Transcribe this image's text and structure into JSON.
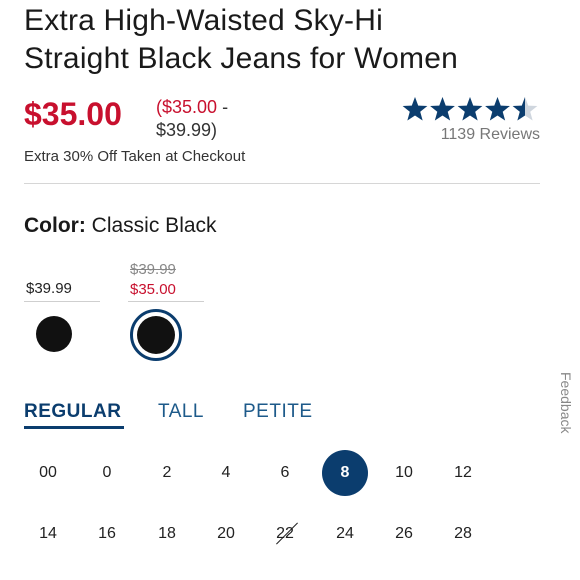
{
  "product": {
    "title_line1": "Extra High-Waisted Sky-Hi",
    "title_line2": "Straight Black Jeans for Women"
  },
  "pricing": {
    "sale_price": "$35.00",
    "range_low": "($35.00",
    "range_sep": " -",
    "range_high": "$39.99)",
    "promo": "Extra 30% Off Taken at Checkout"
  },
  "rating": {
    "value": 4.5,
    "max": 5,
    "reviews_text": "1139 Reviews",
    "star_color": "#0b3d6e"
  },
  "color": {
    "label": "Color:",
    "selected": "Classic Black"
  },
  "swatches": [
    {
      "price": "$39.99",
      "icon": "black-swatch"
    },
    {
      "old_price": "$39.99",
      "new_price": "$35.00",
      "icon": "black-swatch-selected"
    }
  ],
  "fit_tabs": [
    {
      "label": "REGULAR",
      "active": true
    },
    {
      "label": "TALL",
      "active": false
    },
    {
      "label": "PETITE",
      "active": false
    }
  ],
  "sizes": {
    "row1": [
      "00",
      "0",
      "2",
      "4",
      "6",
      "8",
      "10",
      "12"
    ],
    "row2": [
      "14",
      "16",
      "18",
      "20",
      "22",
      "24",
      "26",
      "28"
    ],
    "selected": "8",
    "unavailable": [
      "22"
    ]
  },
  "feedback_label": "Feedback",
  "colors": {
    "sale_red": "#c8102e",
    "navy": "#0b3d6e",
    "tab_blue": "#1d5a8a"
  }
}
